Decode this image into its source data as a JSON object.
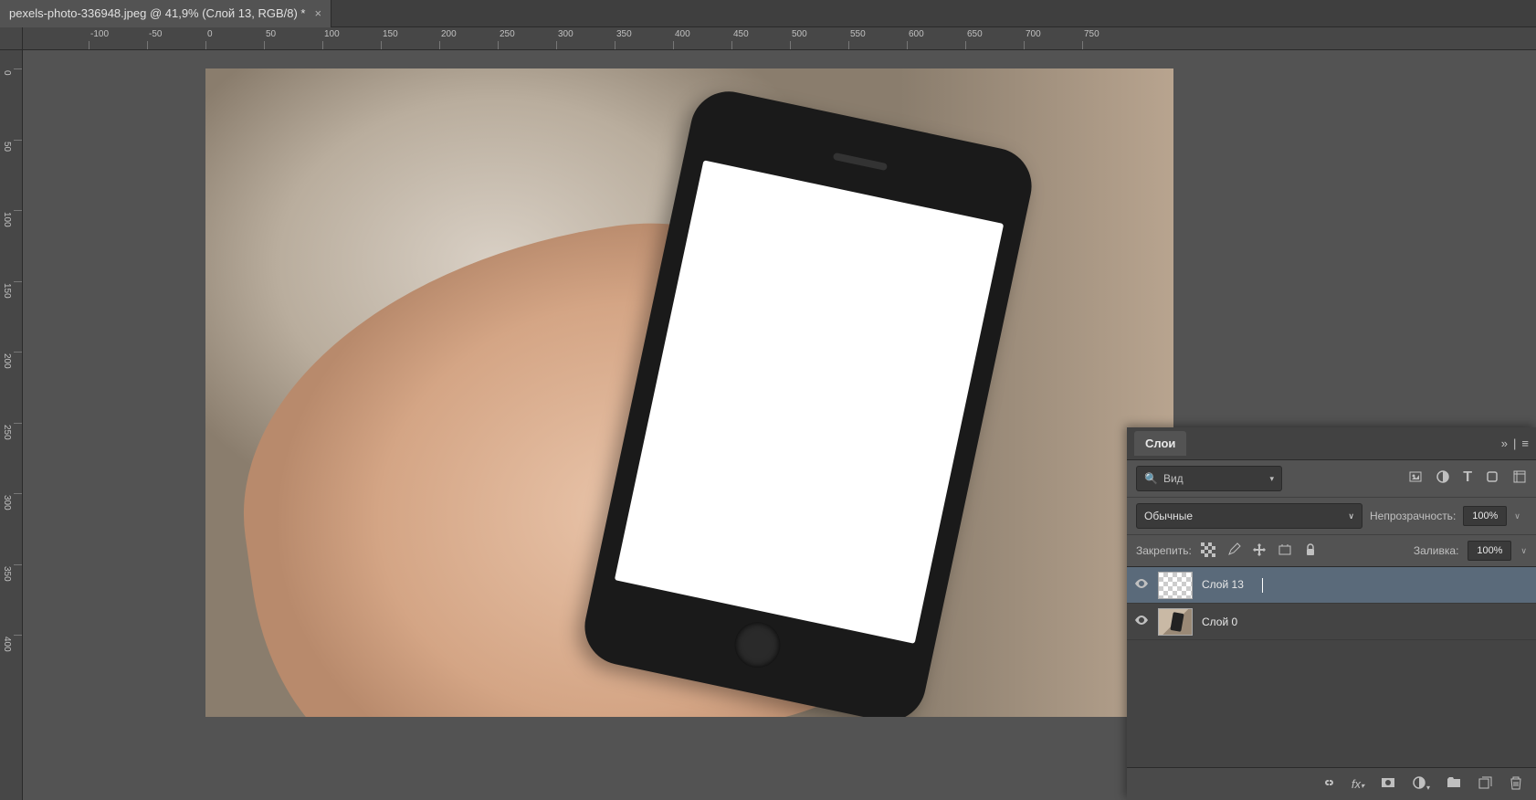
{
  "document": {
    "tab_title": "pexels-photo-336948.jpeg @ 41,9% (Слой 13, RGB/8) *"
  },
  "ruler": {
    "h_ticks": [
      -100,
      -50,
      0,
      50,
      100,
      150,
      200,
      250,
      300,
      350,
      400,
      450,
      500,
      550,
      600,
      650,
      700,
      750
    ],
    "v_ticks": [
      0,
      50,
      100,
      150,
      200,
      250,
      300,
      350,
      400
    ]
  },
  "layers_panel": {
    "title": "Слои",
    "search_placeholder": "Вид",
    "blend_mode": "Обычные",
    "opacity_label": "Непрозрачность:",
    "opacity_value": "100%",
    "lock_label": "Закрепить:",
    "fill_label": "Заливка:",
    "fill_value": "100%",
    "layers": [
      {
        "name": "Слой 13",
        "selected": true,
        "thumb": "transparent"
      },
      {
        "name": "Слой 0",
        "selected": false,
        "thumb": "image"
      }
    ]
  }
}
